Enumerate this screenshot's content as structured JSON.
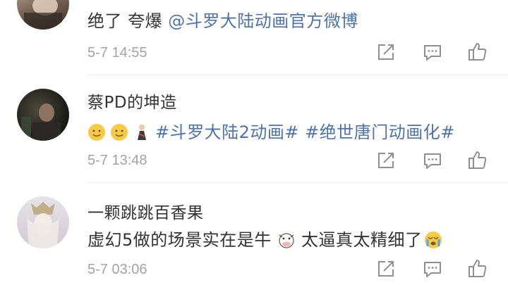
{
  "comments": [
    {
      "content_prefix": "绝了 夸爆 ",
      "mention": "@斗罗大陆动画官方微博",
      "time": "5-7 14:55"
    },
    {
      "username": "蔡PD的坤造",
      "emojis": [
        "smile-emoji",
        "smile-emoji",
        "person-emoji"
      ],
      "hashtag1": "#斗罗大陆2动画#",
      "hashtag2": "#绝世唐门动画化#",
      "time": "5-7 13:48"
    },
    {
      "username": "一颗跳跳百香果",
      "text_before": "虚幻5做的场景实在是牛 ",
      "emoji_cow": "cow-emoji",
      "text_after": " 太逼真太精细了",
      "emoji_end": "crying-emoji",
      "time": "5-7 03:06"
    }
  ],
  "colors": {
    "text": "#333333",
    "link": "#4e73a8",
    "meta": "#a3a3a3",
    "icon": "#8f8f8f"
  }
}
